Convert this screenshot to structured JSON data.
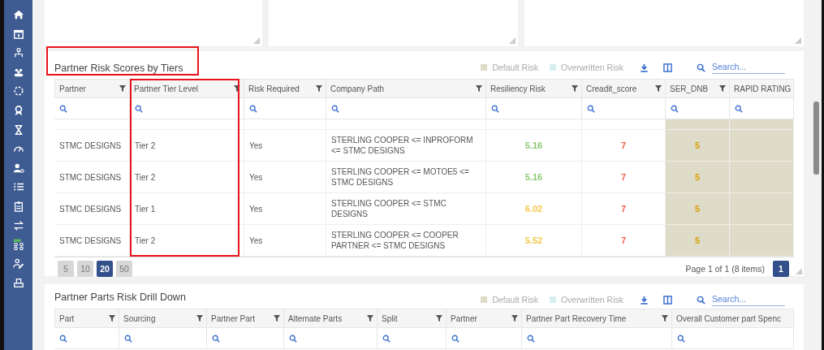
{
  "risk_table": {
    "title": "Partner Risk Scores by Tiers",
    "title_highlighted": true,
    "legend": [
      {
        "label": "Default Risk",
        "color": "#dedbc9"
      },
      {
        "label": "Overwritten Risk",
        "color": "#d8eff0"
      }
    ],
    "search": {
      "placeholder": "Search..."
    },
    "columns": [
      {
        "label": "Partner",
        "filter": true,
        "highlighted": false
      },
      {
        "label": "Partner Tier Level",
        "filter": true,
        "highlighted": true
      },
      {
        "label": "Risk Required",
        "filter": true,
        "highlighted": false
      },
      {
        "label": "Company Path",
        "filter": true,
        "highlighted": false
      },
      {
        "label": "Resiliency Risk",
        "filter": true,
        "highlighted": false
      },
      {
        "label": "Creadit_score",
        "filter": true,
        "highlighted": false
      },
      {
        "label": "SER_DNB",
        "filter": true,
        "highlighted": false
      },
      {
        "label": "RAPID RATING",
        "filter": false,
        "highlighted": false
      }
    ],
    "rows": [
      {
        "cells": [
          {
            "text": "STMC DESIGNS"
          },
          {
            "text": "Tier 2"
          },
          {
            "text": "Yes"
          },
          {
            "text": "STERLING COOPER <= INPROFORM <= STMC DESIGNS"
          },
          {
            "text": "5.16",
            "color": "#8fc873"
          },
          {
            "text": "7",
            "color": "#f0604d"
          },
          {
            "text": "5",
            "color": "#d9a000",
            "default_risk": true
          },
          {
            "default_risk": true
          }
        ]
      },
      {
        "cells": [
          {
            "text": "STMC DESIGNS"
          },
          {
            "text": "Tier 2"
          },
          {
            "text": "Yes"
          },
          {
            "text": "STERLING COOPER <= MOTOE5 <= STMC DESIGNS"
          },
          {
            "text": "5.16",
            "color": "#8fc873"
          },
          {
            "text": "7",
            "color": "#f0604d"
          },
          {
            "text": "5",
            "color": "#d9a000",
            "default_risk": true
          },
          {
            "default_risk": true
          }
        ]
      },
      {
        "cells": [
          {
            "text": "STMC DESIGNS"
          },
          {
            "text": "Tier 1"
          },
          {
            "text": "Yes"
          },
          {
            "text": "STERLING COOPER <= STMC DESIGNS"
          },
          {
            "text": "6.02",
            "color": "#f4c84a"
          },
          {
            "text": "7",
            "color": "#f0604d"
          },
          {
            "text": "5",
            "color": "#d9a000",
            "default_risk": true
          },
          {
            "default_risk": true
          }
        ]
      },
      {
        "cells": [
          {
            "text": "STMC DESIGNS"
          },
          {
            "text": "Tier 2"
          },
          {
            "text": "Yes"
          },
          {
            "text": "STERLING COOPER <= COOPER PARTNER <= STMC DESIGNS"
          },
          {
            "text": "5.52",
            "color": "#f4c84a"
          },
          {
            "text": "7",
            "color": "#f0604d"
          },
          {
            "text": "5",
            "color": "#d9a000",
            "default_risk": true
          },
          {
            "default_risk": true
          }
        ]
      }
    ],
    "page_sizes": [
      {
        "label": "5",
        "selected": false
      },
      {
        "label": "10",
        "selected": false
      },
      {
        "label": "20",
        "selected": true
      },
      {
        "label": "50",
        "selected": false
      }
    ],
    "page_info": "Page 1 of 1 (8 items)",
    "pages": [
      {
        "label": "1",
        "selected": true
      }
    ]
  },
  "parts_table": {
    "title": "Partner Parts Risk Drill Down",
    "legend": [
      {
        "label": "Default Risk",
        "color": "#dedbc9"
      },
      {
        "label": "Overwritten Risk",
        "color": "#d8eff0"
      }
    ],
    "search": {
      "placeholder": "Search..."
    },
    "columns": [
      {
        "label": "Part",
        "filter": true
      },
      {
        "label": "Sourcing",
        "filter": true
      },
      {
        "label": "Partner Part",
        "filter": true
      },
      {
        "label": "Alternate Parts",
        "filter": true
      },
      {
        "label": "Split",
        "filter": true
      },
      {
        "label": "Partner",
        "filter": true
      },
      {
        "label": "Partner Part Recovery Time",
        "filter": true
      },
      {
        "label": "Overall Customer part Spenc",
        "filter": false
      }
    ]
  }
}
